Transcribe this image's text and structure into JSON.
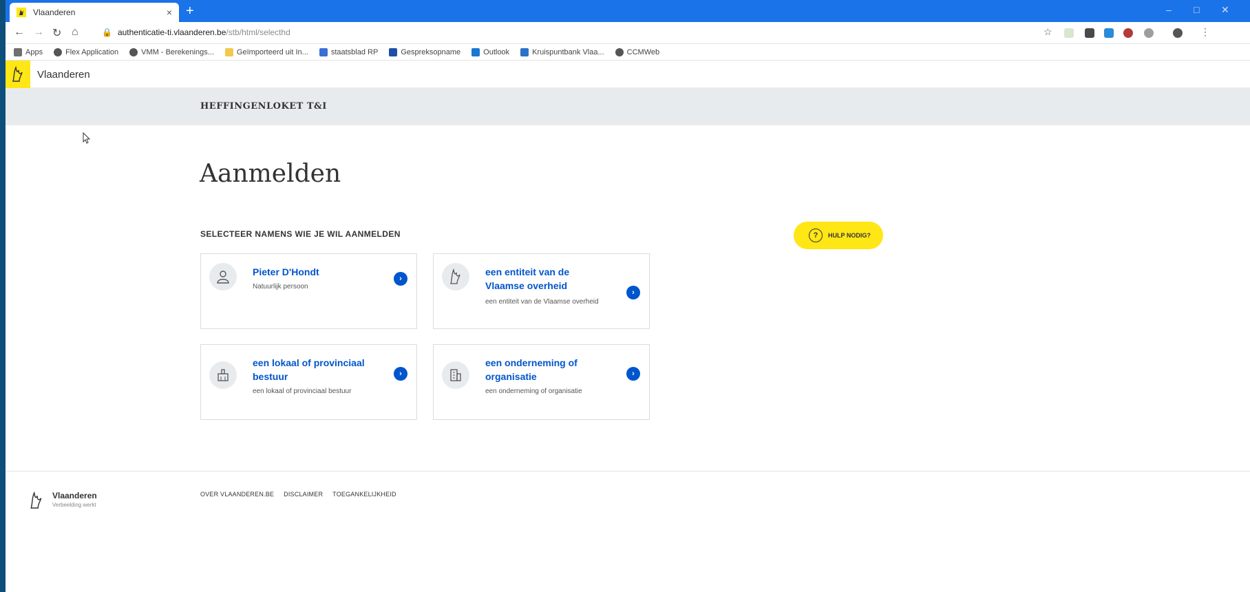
{
  "browser": {
    "tab_title": "Vlaanderen",
    "tab_close": "×",
    "new_tab": "+",
    "url_host": "authenticatie-ti.vlaanderen.be",
    "url_path": "/stb/html/selecthd",
    "window_controls": [
      "–",
      "□",
      "✕"
    ],
    "bookmarks": [
      {
        "label": "Apps",
        "color": "#6f6f6f"
      },
      {
        "label": "Flex Application",
        "color": "#555555"
      },
      {
        "label": "VMM - Berekenings...",
        "color": "#555555"
      },
      {
        "label": "Geïmporteerd uit In...",
        "color": "#f2c94c"
      },
      {
        "label": "staatsblad RP",
        "color": "#3b6fd6"
      },
      {
        "label": "Gespreksopname",
        "color": "#1e4fa8"
      },
      {
        "label": "Outlook",
        "color": "#1976d2"
      },
      {
        "label": "Kruispuntbank Vlaa...",
        "color": "#2a73c9"
      },
      {
        "label": "CCMWeb",
        "color": "#555555"
      }
    ]
  },
  "site": {
    "name": "Vlaanderen",
    "subheader": "HEFFINGENLOKET T&I"
  },
  "main": {
    "title": "Aanmelden",
    "section_label": "SELECTEER NAMENS WIE JE WIL AANMELDEN",
    "help_button": "HULP NODIG?",
    "help_icon": "?",
    "cards": [
      {
        "title": "Pieter D'Hondt",
        "subtitle": "Natuurlijk persoon",
        "icon": "person-icon"
      },
      {
        "title": "een entiteit van de Vlaamse overheid",
        "subtitle": "een entiteit van de Vlaamse overheid",
        "icon": "flemish-lion-icon"
      },
      {
        "title": "een lokaal of provinciaal bestuur",
        "subtitle": "een lokaal of provinciaal bestuur",
        "icon": "city-hall-icon"
      },
      {
        "title": "een onderneming of organisatie",
        "subtitle": "een onderneming of organisatie",
        "icon": "building-icon"
      }
    ],
    "arrow_glyph": "›"
  },
  "footer": {
    "name": "Vlaanderen",
    "tagline": "Verbeelding werkt",
    "links": [
      "OVER VLAANDEREN.BE",
      "DISCLAIMER",
      "TOEGANKELIJKHEID"
    ]
  },
  "colors": {
    "accent_yellow": "#ffe615",
    "link_blue": "#0055cc",
    "chrome_blue": "#1a73e8",
    "subheader_gray": "#e8ebee"
  }
}
